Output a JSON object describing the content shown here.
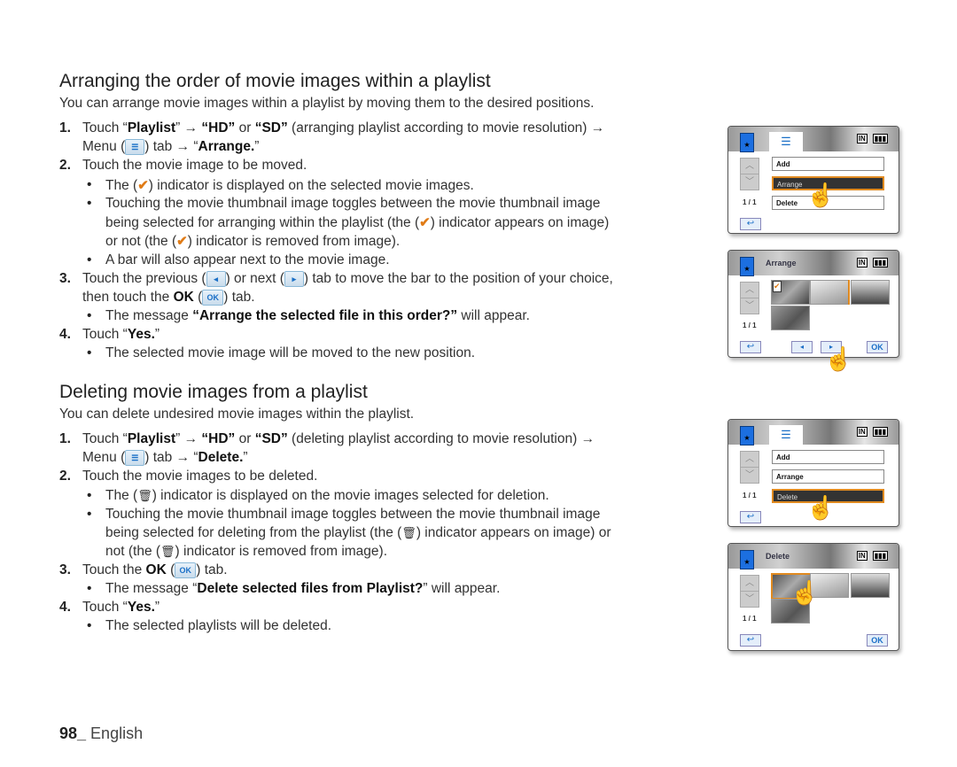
{
  "section1": {
    "heading": "Arranging the order of movie images within a playlist",
    "intro": "You can arrange movie images within a playlist by moving them to the desired positions.",
    "step1": {
      "num": "1.",
      "a": "Touch “",
      "b1": "Playlist",
      "c": "” → ",
      "b2": "“HD”",
      "d": " or ",
      "b3": "“SD”",
      "e": " (arranging playlist according to movie resolution) →",
      "f": "Menu (",
      "g": ") tab → “",
      "b4": "Arrange.",
      "h": "”"
    },
    "step2": {
      "num": "2.",
      "text": "Touch the movie image to be moved."
    },
    "bullets2": [
      {
        "a": "The (",
        "b": ") indicator is displayed on the selected movie images."
      },
      {
        "l1": "Touching the movie thumbnail image toggles between the movie thumbnail image",
        "l2a": "being selected for arranging within the playlist (the (",
        "l2b": ") indicator appears on image)",
        "l3a": "or not (the (",
        "l3b": ") indicator is removed from image)."
      },
      {
        "text": "A bar will also appear next to the movie image."
      }
    ],
    "step3": {
      "num": "3.",
      "a": "Touch the previous (",
      "b": ") or next (",
      "c": ") tab to move the bar to the position of your choice,",
      "d": "then touch the ",
      "ok": "OK",
      "e": " (",
      "f": ") tab."
    },
    "bullet3": {
      "a": "The message ",
      "b": "“Arrange the selected file in this order?”",
      "c": " will appear."
    },
    "step4": {
      "num": "4.",
      "a": "Touch “",
      "b": "Yes.",
      "c": "”"
    },
    "bullet4": "The selected movie image will be moved to the new position."
  },
  "section2": {
    "heading": "Deleting movie images from a playlist",
    "intro": "You can delete undesired movie images within the playlist.",
    "step1": {
      "num": "1.",
      "a": "Touch “",
      "b1": "Playlist",
      "c": "” → ",
      "b2": "“HD”",
      "d": " or ",
      "b3": "“SD”",
      "e": " (deleting playlist according to movie resolution) →",
      "f": "Menu (",
      "g": ") tab → “",
      "b4": "Delete.",
      "h": "”"
    },
    "step2": {
      "num": "2.",
      "text": "Touch the movie images to be deleted."
    },
    "bullets2": [
      {
        "a": "The (",
        "b": ") indicator is displayed on the movie images selected for deletion."
      },
      {
        "l1": "Touching the movie thumbnail image toggles between the movie thumbnail image",
        "l2a": "being selected for deleting from the playlist (the (",
        "l2b": ") indicator appears on image) or",
        "l3a": "not (the (",
        "l3b": ") indicator is removed from image)."
      }
    ],
    "step3": {
      "num": "3.",
      "a": "Touch the ",
      "ok": "OK",
      "b": " (",
      "c": ") tab."
    },
    "bullet3": {
      "a": "The message “",
      "b": "Delete selected files from Playlist?",
      "c": "” will appear."
    },
    "step4": {
      "num": "4.",
      "a": "Touch “",
      "b": "Yes.",
      "c": "”"
    },
    "bullet4": "The selected playlists will be deleted."
  },
  "icons": {
    "menu": "☰",
    "prev": "◂",
    "next": "▸",
    "ok": "OK",
    "check": "✔",
    "trash": "🗑",
    "bullet": "•"
  },
  "screens": {
    "menu_items": [
      "Add",
      "Arrange",
      "Delete"
    ],
    "page": "1 / 1",
    "arrange_title": "Arrange",
    "delete_title": "Delete",
    "status_in": "IN",
    "status_batt": "▮▮▮",
    "up": "︿",
    "down": "﹀",
    "back": "↩",
    "ok": "OK",
    "prev": "◂",
    "next": "▸",
    "star": "★",
    "hand": "☝"
  },
  "footer": {
    "page": "98_",
    "lang": " English"
  }
}
